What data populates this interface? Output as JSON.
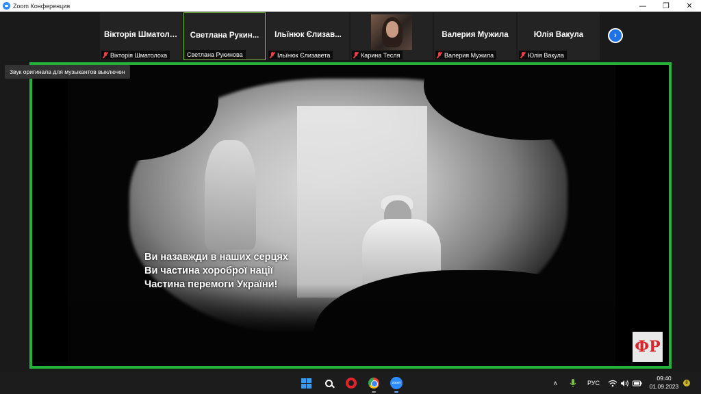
{
  "window": {
    "title": "Zoom Конференция",
    "minimize_icon": "—",
    "restore_icon": "❐",
    "close_icon": "✕"
  },
  "participants": [
    {
      "display_name": "Вікторія Шматоло...",
      "label": "Вікторія Шматолоха",
      "muted": true,
      "active": false
    },
    {
      "display_name": "Светлана Рукин...",
      "label": "Светлана Рукинова",
      "muted": false,
      "active": true
    },
    {
      "display_name": "Ільїнюк Єлизав...",
      "label": "Ільїнюк Єлизавета",
      "muted": true,
      "active": false
    },
    {
      "display_name": "",
      "label": "Карина Тесля",
      "muted": true,
      "active": false,
      "has_photo": true
    },
    {
      "display_name": "Валерия Мужила",
      "label": "Валерия Мужила",
      "muted": true,
      "active": false
    },
    {
      "display_name": "Юлія Вакула",
      "label": "Юлія Вакула",
      "muted": true,
      "active": false
    }
  ],
  "gallery": {
    "next_icon": "›"
  },
  "notification": "Звук оригинала для музыкантов выключен",
  "shared_video": {
    "caption_lines": [
      "Ви назавжди в наших серцях",
      "Ви частина хороброї нації",
      "Частина перемоги України!"
    ],
    "logo_text": "ФР"
  },
  "taskbar": {
    "language": "РУС",
    "time": "09:40",
    "date": "01.09.2023",
    "notification_count": "8",
    "tray_chevron": "∧",
    "wifi_icon": "wifi",
    "volume_icon": "volume",
    "battery_icon": "battery"
  },
  "colors": {
    "share_border": "#23b23a",
    "active_tile_border": "#7ec043",
    "mic_muted": "#e8414a",
    "zoom_blue": "#2d8cff"
  }
}
